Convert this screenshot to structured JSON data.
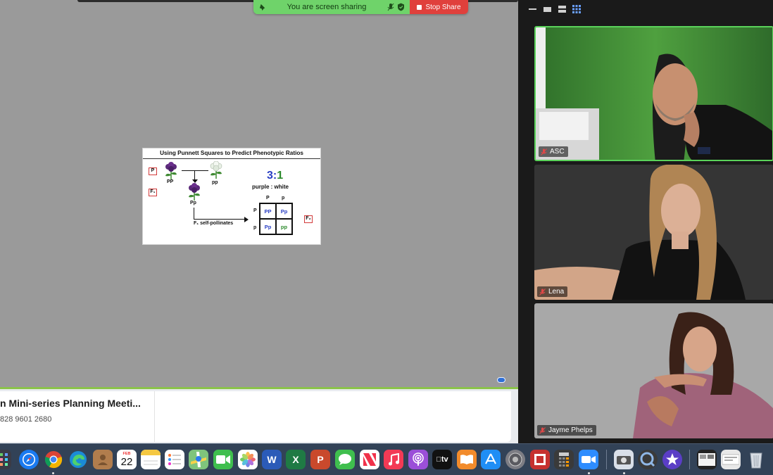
{
  "share_bar": {
    "status": "You are screen sharing",
    "stop_label": "Stop Share",
    "icons": [
      "pin-icon",
      "mic-icon",
      "shield-icon"
    ]
  },
  "slide": {
    "title": "Using Punnett Squares to Predict Phenotypic Ratios",
    "gen_p": "P",
    "gen_f1": "F₁",
    "gen_f2": "F₂",
    "parent1_genotype": "PP",
    "parent2_genotype": "pp",
    "f1_genotype": "Pp",
    "ratio_3": "3",
    "ratio_colon": ":",
    "ratio_1": "1",
    "ratio_label": "purple : white",
    "self_pollinates": "F₁ self-pollinates",
    "gamete_top_1": "P",
    "gamete_top_2": "p",
    "gamete_left_1": "P",
    "gamete_left_2": "p",
    "cells": [
      {
        "text": "PP",
        "color": "#2a3fc4"
      },
      {
        "text": "Pp",
        "color": "#2a3fc4"
      },
      {
        "text": "Pp",
        "color": "#2a3fc4"
      },
      {
        "text": "pp",
        "color": "#2c8a2c"
      }
    ],
    "colors": {
      "purple_flower": "#5b2a7a",
      "white_flower": "#e9f1e6",
      "stem": "#3f8a32"
    }
  },
  "meeting": {
    "title": "n Mini-series Planning Meeti...",
    "id": "828 9601 2680"
  },
  "gallery": {
    "participants": [
      {
        "name": "ASC",
        "active": true
      },
      {
        "name": "Lena",
        "active": false
      },
      {
        "name": "Jayme Phelps",
        "active": false
      }
    ],
    "active_border_color": "#5ad25a"
  },
  "dock": {
    "calendar_month": "FEB",
    "calendar_day": "22",
    "tv_label": "tv",
    "apps": [
      "launchpad-icon",
      "safari-icon",
      "chrome-icon",
      "edge-icon",
      "contacts-icon",
      "calendar-icon",
      "notes-icon",
      "reminders-icon",
      "maps-icon",
      "facetime-icon",
      "photos-icon",
      "word-icon",
      "excel-icon",
      "powerpoint-icon",
      "messages-icon",
      "news-icon",
      "music-icon",
      "podcasts-icon",
      "appletv-icon",
      "books-icon",
      "appstore-icon",
      "system-preferences-icon",
      "photo-booth-icon",
      "calculator-icon",
      "zoom-icon",
      "screenshot-icon",
      "quicktime-icon",
      "imovie-icon",
      "downloads-stack-icon",
      "documents-stack-icon",
      "trash-icon"
    ]
  }
}
